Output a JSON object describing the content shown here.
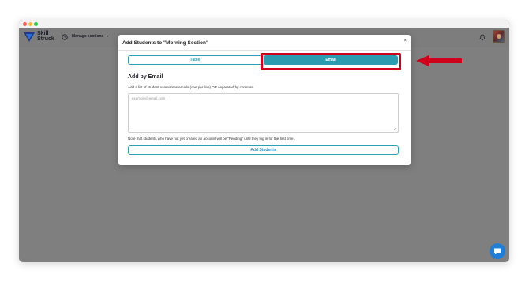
{
  "app": {
    "brand_line1": "Skill",
    "brand_line2": "Struck",
    "manage_sections": "Manage sections",
    "caret": "▾"
  },
  "modal": {
    "title": "Add Students to \"Morning Section\"",
    "close": "×",
    "tabs": [
      {
        "label": "Table",
        "active": false
      },
      {
        "label": "Email",
        "active": true
      }
    ],
    "heading": "Add by Email",
    "instructions": "Add a list of student usernames/emails (one per line) OR separated by commas.",
    "placeholder": "example@email.com",
    "note": "Note that students who have not yet created an account will be \"Pending\" until they log in for the first time.",
    "submit": "Add Students"
  },
  "colors": {
    "accent": "#2b9bb0",
    "highlight": "#d0021b",
    "chat": "#1f7fd8"
  },
  "icons": [
    "clock-icon",
    "bell-icon",
    "close-icon",
    "chat-icon",
    "arrow-icon"
  ]
}
